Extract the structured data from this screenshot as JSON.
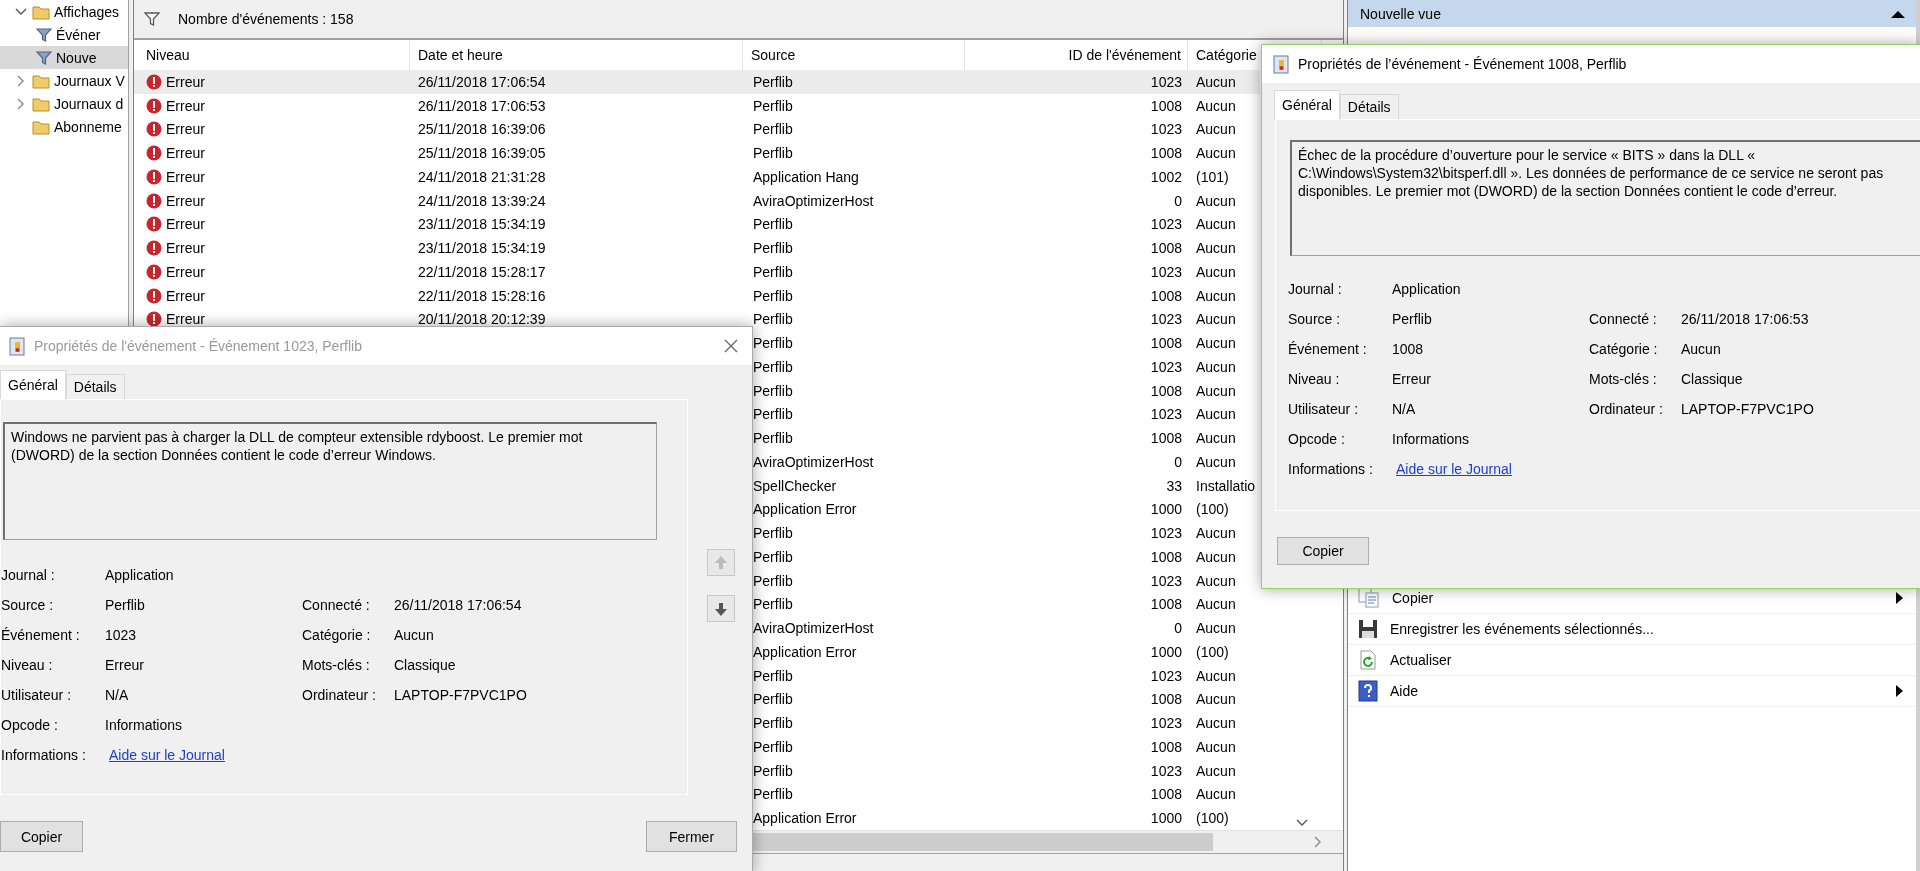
{
  "tree": {
    "items": [
      {
        "label": "Affichages",
        "expanded": true,
        "selected": false,
        "children": [
          {
            "label": "Événer",
            "selected": false
          },
          {
            "label": "Nouve",
            "selected": true
          }
        ]
      },
      {
        "label": "Journaux V",
        "expanded": false,
        "selected": false
      },
      {
        "label": "Journaux d",
        "expanded": false,
        "selected": false
      },
      {
        "label": "Abonneme",
        "selected": false
      }
    ]
  },
  "events": {
    "count_label": "Nombre d'événements : 158",
    "columns": [
      "Niveau",
      "Date et heure",
      "Source",
      "ID de l'événement",
      "Catégorie"
    ],
    "rows": [
      {
        "niveau": "Erreur",
        "date": "26/11/2018 17:06:54",
        "source": "Perflib",
        "id": "1023",
        "categorie": "Aucun",
        "selected": true
      },
      {
        "niveau": "Erreur",
        "date": "26/11/2018 17:06:53",
        "source": "Perflib",
        "id": "1008",
        "categorie": "Aucun",
        "selected": false
      },
      {
        "niveau": "Erreur",
        "date": "25/11/2018 16:39:06",
        "source": "Perflib",
        "id": "1023",
        "categorie": "Aucun",
        "selected": false
      },
      {
        "niveau": "Erreur",
        "date": "25/11/2018 16:39:05",
        "source": "Perflib",
        "id": "1008",
        "categorie": "Aucun",
        "selected": false
      },
      {
        "niveau": "Erreur",
        "date": "24/11/2018 21:31:28",
        "source": "Application Hang",
        "id": "1002",
        "categorie": "(101)",
        "selected": false
      },
      {
        "niveau": "Erreur",
        "date": "24/11/2018 13:39:24",
        "source": "AviraOptimizerHost",
        "id": "0",
        "categorie": "Aucun",
        "selected": false
      },
      {
        "niveau": "Erreur",
        "date": "23/11/2018 15:34:19",
        "source": "Perflib",
        "id": "1023",
        "categorie": "Aucun",
        "selected": false
      },
      {
        "niveau": "Erreur",
        "date": "23/11/2018 15:34:19",
        "source": "Perflib",
        "id": "1008",
        "categorie": "Aucun",
        "selected": false
      },
      {
        "niveau": "Erreur",
        "date": "22/11/2018 15:28:17",
        "source": "Perflib",
        "id": "1023",
        "categorie": "Aucun",
        "selected": false
      },
      {
        "niveau": "Erreur",
        "date": "22/11/2018 15:28:16",
        "source": "Perflib",
        "id": "1008",
        "categorie": "Aucun",
        "selected": false
      },
      {
        "niveau": "Erreur",
        "date": "20/11/2018 20:12:39",
        "source": "Perflib",
        "id": "1023",
        "categorie": "Aucun",
        "selected": false
      },
      {
        "source": "Perflib",
        "id": "1008",
        "categorie": "Aucun",
        "selected": false
      },
      {
        "source": "Perflib",
        "id": "1023",
        "categorie": "Aucun",
        "selected": false
      },
      {
        "source": "Perflib",
        "id": "1008",
        "categorie": "Aucun",
        "selected": false
      },
      {
        "source": "Perflib",
        "id": "1023",
        "categorie": "Aucun",
        "selected": false
      },
      {
        "source": "Perflib",
        "id": "1008",
        "categorie": "Aucun",
        "selected": false
      },
      {
        "source": "AviraOptimizerHost",
        "id": "0",
        "categorie": "Aucun",
        "selected": false
      },
      {
        "source": "SpellChecker",
        "id": "33",
        "categorie": "Installatio",
        "selected": false
      },
      {
        "source": "Application Error",
        "id": "1000",
        "categorie": "(100)",
        "selected": false
      },
      {
        "source": "Perflib",
        "id": "1023",
        "categorie": "Aucun",
        "selected": false
      },
      {
        "source": "Perflib",
        "id": "1008",
        "categorie": "Aucun",
        "selected": false
      },
      {
        "source": "Perflib",
        "id": "1023",
        "categorie": "Aucun",
        "selected": false
      },
      {
        "source": "Perflib",
        "id": "1008",
        "categorie": "Aucun",
        "selected": false
      },
      {
        "source": "AviraOptimizerHost",
        "id": "0",
        "categorie": "Aucun",
        "selected": false
      },
      {
        "source": "Application Error",
        "id": "1000",
        "categorie": "(100)",
        "selected": false
      },
      {
        "source": "Perflib",
        "id": "1023",
        "categorie": "Aucun",
        "selected": false
      },
      {
        "source": "Perflib",
        "id": "1008",
        "categorie": "Aucun",
        "selected": false
      },
      {
        "source": "Perflib",
        "id": "1023",
        "categorie": "Aucun",
        "selected": false
      },
      {
        "source": "Perflib",
        "id": "1008",
        "categorie": "Aucun",
        "selected": false
      },
      {
        "source": "Perflib",
        "id": "1023",
        "categorie": "Aucun",
        "selected": false
      },
      {
        "source": "Perflib",
        "id": "1008",
        "categorie": "Aucun",
        "selected": false
      },
      {
        "source": "Application Error",
        "id": "1000",
        "categorie": "(100)",
        "selected": false
      }
    ]
  },
  "actions": {
    "header": "Nouvelle vue",
    "items": [
      {
        "label": "Copier",
        "kind": "copy",
        "submenu": true
      },
      {
        "label": "Enregistrer les événements sélectionnés...",
        "kind": "save",
        "submenu": false
      },
      {
        "label": "Actualiser",
        "kind": "refresh",
        "submenu": false
      },
      {
        "label": "Aide",
        "kind": "help",
        "submenu": true
      }
    ]
  },
  "dialogs": [
    {
      "title": "Propriétés de l'événement - Événement 1023, Perflib",
      "active": false,
      "tabs": [
        {
          "label": "Général",
          "selected": true
        },
        {
          "label": "Détails",
          "selected": false
        }
      ],
      "message": "Windows ne parvient pas à charger la DLL de compteur extensible rdyboost. Le premier mot (DWORD) de la section Données contient le code d’erreur Windows.",
      "left_fields": [
        {
          "label": "Journal :",
          "value": "Application"
        },
        {
          "label": "Source :",
          "value": "Perflib"
        },
        {
          "label": "Événement :",
          "value": "1023"
        },
        {
          "label": "Niveau :",
          "value": "Erreur"
        },
        {
          "label": "Utilisateur :",
          "value": "N/A"
        },
        {
          "label": "Opcode :",
          "value": "Informations"
        },
        {
          "label": "Informations :",
          "value": "Aide sur le Journal",
          "link": true
        }
      ],
      "right_fields": [
        {
          "label": "Connecté :",
          "value": "26/11/2018 17:06:54"
        },
        {
          "label": "Catégorie :",
          "value": "Aucun"
        },
        {
          "label": "Mots-clés :",
          "value": "Classique"
        },
        {
          "label": "Ordinateur :",
          "value": "LAPTOP-F7PVC1PO"
        }
      ],
      "buttons": [
        "Copier",
        "Fermer"
      ]
    },
    {
      "title": "Propriétés de l’événement - Événement 1008, Perflib",
      "active": true,
      "tabs": [
        {
          "label": "Général",
          "selected": true
        },
        {
          "label": "Détails",
          "selected": false
        }
      ],
      "message": "Échec de la procédure d’ouverture pour le service « BITS » dans la DLL « C:\\Windows\\System32\\bitsperf.dll ». Les données de performance de ce service ne seront pas disponibles. Le premier mot (DWORD) de la section Données contient le code d’erreur.",
      "left_fields": [
        {
          "label": "Journal :",
          "value": "Application"
        },
        {
          "label": "Source :",
          "value": "Perflib"
        },
        {
          "label": "Événement :",
          "value": "1008"
        },
        {
          "label": "Niveau :",
          "value": "Erreur"
        },
        {
          "label": "Utilisateur :",
          "value": "N/A"
        },
        {
          "label": "Opcode :",
          "value": "Informations"
        },
        {
          "label": "Informations :",
          "value": "Aide sur le Journal",
          "link": true
        }
      ],
      "right_fields": [
        {
          "label": "Connecté :",
          "value": "26/11/2018 17:06:53"
        },
        {
          "label": "Catégorie :",
          "value": "Aucun"
        },
        {
          "label": "Mots-clés :",
          "value": "Classique"
        },
        {
          "label": "Ordinateur :",
          "value": "LAPTOP-F7PVC1PO"
        }
      ],
      "buttons": [
        "Copier"
      ]
    }
  ]
}
